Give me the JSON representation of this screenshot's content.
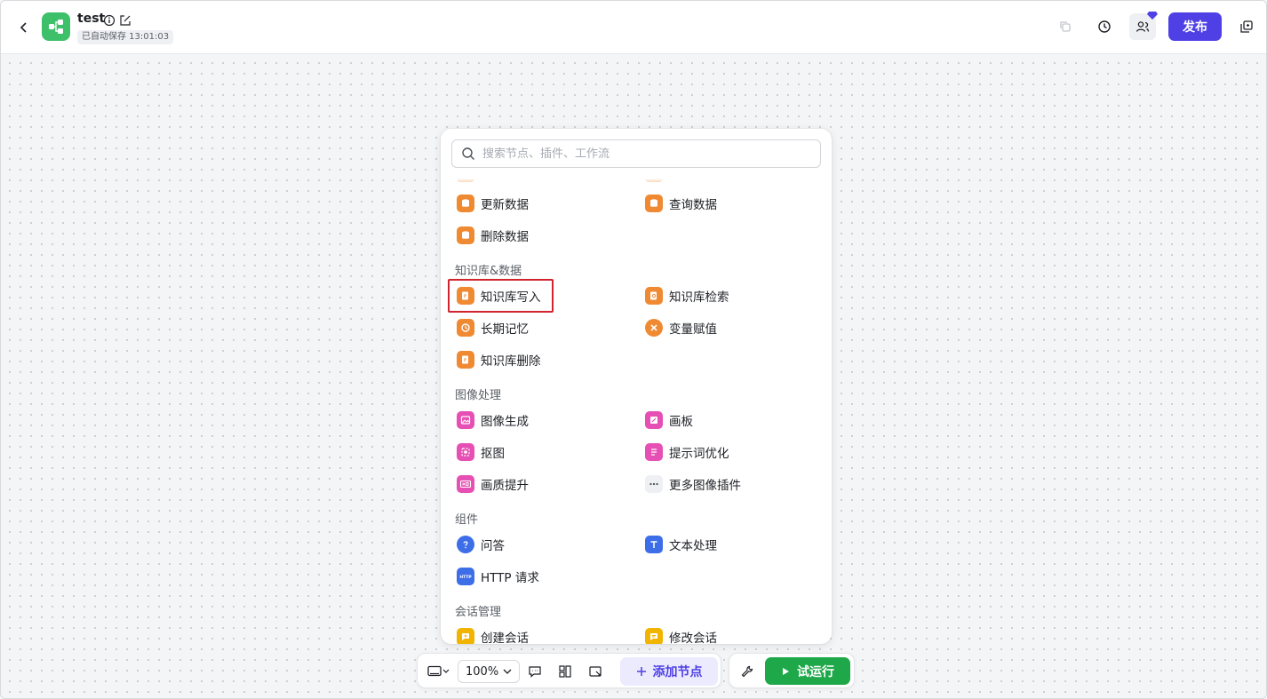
{
  "header": {
    "title": "test",
    "autosave": "已自动保存 13:01:03",
    "publish_label": "发布",
    "accent": "#4e40e5"
  },
  "panel": {
    "search_placeholder": "搜索节点、插件、工作流",
    "sections": [
      {
        "title": "",
        "items": [
          {
            "label": "更新数据",
            "icon": "database-update-icon",
            "color": "#f08a32"
          },
          {
            "label": "查询数据",
            "icon": "database-query-icon",
            "color": "#f08a32"
          },
          {
            "label": "删除数据",
            "icon": "database-delete-icon",
            "color": "#f08a32"
          }
        ]
      },
      {
        "title": "知识库&数据",
        "items": [
          {
            "label": "知识库写入",
            "icon": "knowledge-write-icon",
            "color": "#f08a32"
          },
          {
            "label": "知识库检索",
            "icon": "knowledge-search-icon",
            "color": "#f08a32"
          },
          {
            "label": "长期记忆",
            "icon": "memory-icon",
            "color": "#f08a32"
          },
          {
            "label": "变量赋值",
            "icon": "variable-icon",
            "color": "#f08a32"
          },
          {
            "label": "知识库删除",
            "icon": "knowledge-delete-icon",
            "color": "#f08a32"
          }
        ]
      },
      {
        "title": "图像处理",
        "items": [
          {
            "label": "图像生成",
            "icon": "image-generate-icon",
            "color": "#e64fb3"
          },
          {
            "label": "画板",
            "icon": "canvas-icon",
            "color": "#e64fb3"
          },
          {
            "label": "抠图",
            "icon": "cutout-icon",
            "color": "#e64fb3"
          },
          {
            "label": "提示词优化",
            "icon": "prompt-optimize-icon",
            "color": "#e64fb3"
          },
          {
            "label": "画质提升",
            "icon": "hd-icon",
            "color": "#e64fb3"
          },
          {
            "label": "更多图像插件",
            "icon": "more-icon",
            "color": "#eef0f3"
          }
        ]
      },
      {
        "title": "组件",
        "items": [
          {
            "label": "问答",
            "icon": "question-icon",
            "color": "#3d6ee8"
          },
          {
            "label": "文本处理",
            "icon": "text-process-icon",
            "color": "#3d6ee8"
          },
          {
            "label": "HTTP 请求",
            "icon": "http-icon",
            "color": "#3d6ee8"
          }
        ]
      },
      {
        "title": "会话管理",
        "items": [
          {
            "label": "创建会话",
            "icon": "create-chat-icon",
            "color": "#f1b400"
          },
          {
            "label": "修改会话",
            "icon": "edit-chat-icon",
            "color": "#f1b400"
          }
        ]
      }
    ]
  },
  "toolbar": {
    "zoom": "100%",
    "add_node_label": "添加节点",
    "run_label": "试运行"
  }
}
